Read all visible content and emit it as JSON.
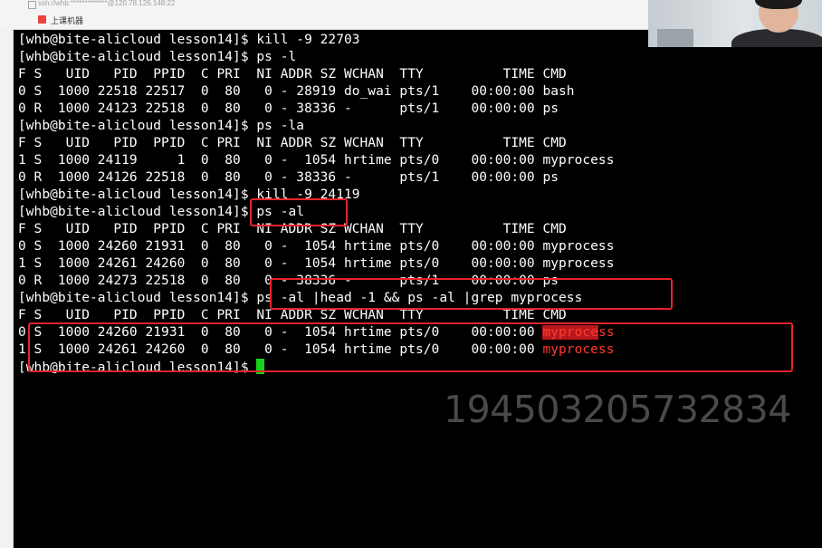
{
  "title_bar": {
    "ssh_address": "ssh://whb:*************@120.78.126.148:22",
    "tab_label": "上课机器"
  },
  "terminal": {
    "lines": [
      "[whb@bite-alicloud lesson14]$ kill -9 22703",
      "[whb@bite-alicloud lesson14]$ ps -l",
      "F S   UID   PID  PPID  C PRI  NI ADDR SZ WCHAN  TTY          TIME CMD",
      "0 S  1000 22518 22517  0  80   0 - 28919 do_wai pts/1    00:00:00 bash",
      "0 R  1000 24123 22518  0  80   0 - 38336 -      pts/1    00:00:00 ps",
      "[whb@bite-alicloud lesson14]$ ps -la",
      "F S   UID   PID  PPID  C PRI  NI ADDR SZ WCHAN  TTY          TIME CMD",
      "1 S  1000 24119     1  0  80   0 -  1054 hrtime pts/0    00:00:00 myprocess",
      "0 R  1000 24126 22518  0  80   0 - 38336 -      pts/1    00:00:00 ps",
      "[whb@bite-alicloud lesson14]$ kill -9 24119",
      "[whb@bite-alicloud lesson14]$ ps -al",
      "F S   UID   PID  PPID  C PRI  NI ADDR SZ WCHAN  TTY          TIME CMD",
      "0 S  1000 24260 21931  0  80   0 -  1054 hrtime pts/0    00:00:00 myprocess",
      "1 S  1000 24261 24260  0  80   0 -  1054 hrtime pts/0    00:00:00 myprocess",
      "0 R  1000 24273 22518  0  80   0 - 38336 -      pts/1    00:00:00 ps",
      "[whb@bite-alicloud lesson14]$ ps -al |head -1 && ps -al |grep myprocess",
      "F S   UID   PID  PPID  C PRI  NI ADDR SZ WCHAN  TTY          TIME CMD"
    ],
    "grep_rows": [
      {
        "prefix": "0 S  1000 24260 21931  0  80   0 -  1054 hrtime pts/0    00:00:00 ",
        "match": "myproce",
        "rest": "ss"
      },
      {
        "prefix": "1 S  1000 24261 24260  0  80   0 -  1054 hrtime pts/0    00:00:00 ",
        "match": "",
        "rest": "myprocess"
      }
    ],
    "prompt": "[whb@bite-alicloud lesson14]$ ",
    "colors": {
      "background": "#000000",
      "text": "#ffffff",
      "grep_match": "#ff3b30",
      "cursor": "#18d318",
      "annotation": "#e8232b"
    }
  },
  "watermark": "194503205732834"
}
